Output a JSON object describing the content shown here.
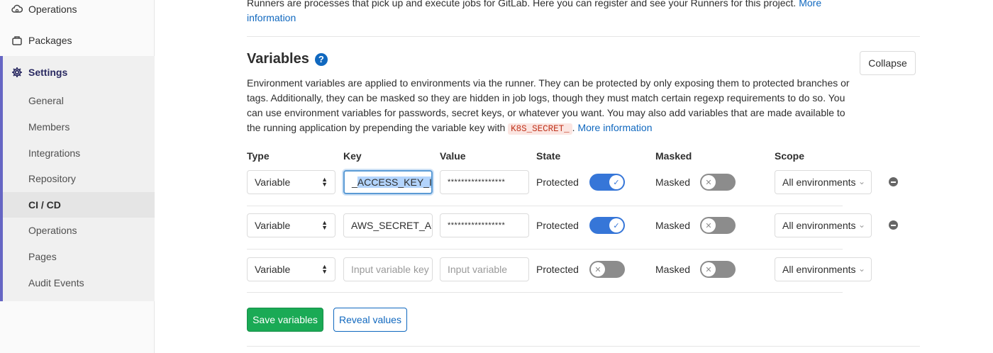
{
  "sidebar": {
    "top_items": [
      {
        "label": "Operations",
        "icon": "cloud-gear-icon"
      },
      {
        "label": "Packages",
        "icon": "package-icon"
      }
    ],
    "settings": {
      "label": "Settings",
      "icon": "gear-icon"
    },
    "sub_items": [
      {
        "label": "General"
      },
      {
        "label": "Members"
      },
      {
        "label": "Integrations"
      },
      {
        "label": "Repository"
      },
      {
        "label": "CI / CD",
        "active": true
      },
      {
        "label": "Operations"
      },
      {
        "label": "Pages"
      },
      {
        "label": "Audit Events"
      }
    ]
  },
  "runners": {
    "text": "Runners are processes that pick up and execute jobs for GitLab. Here you can register and see your Runners for this project.",
    "link_part1": "More",
    "link_part2": "information"
  },
  "variables": {
    "title": "Variables",
    "help_glyph": "?",
    "collapse_label": "Collapse",
    "description": {
      "text1": "Environment variables are applied to environments via the runner. They can be protected by only exposing them to protected branches or",
      "text2": "tags. Additionally, they can be masked so they are hidden in job logs, though they must match certain regexp requirements to do so. You",
      "text3": "can use environment variables for passwords, secret keys, or whatever you want. You may also add variables that are made available to the",
      "text4": "running application by prepending the variable key with",
      "code": "K8S_SECRET_",
      "dot": ".",
      "more_info": "More information"
    },
    "columns": {
      "type": "Type",
      "key": "Key",
      "value": "Value",
      "state": "State",
      "masked": "Masked",
      "scope": "Scope"
    },
    "rows": [
      {
        "type": "Variable",
        "key_prefix": "_",
        "key_selected": "ACCESS_KEY_ID",
        "value": "*****************",
        "protected_label": "Protected",
        "protected": true,
        "masked_label": "Masked",
        "masked": false,
        "scope": "All environments"
      },
      {
        "type": "Variable",
        "key": "AWS_SECRET_AC",
        "value": "*****************",
        "protected_label": "Protected",
        "protected": true,
        "masked_label": "Masked",
        "masked": false,
        "scope": "All environments"
      },
      {
        "type": "Variable",
        "key_placeholder": "Input variable key",
        "value_placeholder": "Input variable",
        "protected_label": "Protected",
        "protected": false,
        "masked_label": "Masked",
        "masked": false,
        "scope": "All environments"
      }
    ],
    "save_label": "Save variables",
    "reveal_label": "Reveal values"
  },
  "colors": {
    "accent": "#1068bf",
    "save": "#1aaa55",
    "toggle_on": "#3676d8",
    "toggle_off": "#8c8c8c",
    "settings_bar": "#6666c4"
  }
}
